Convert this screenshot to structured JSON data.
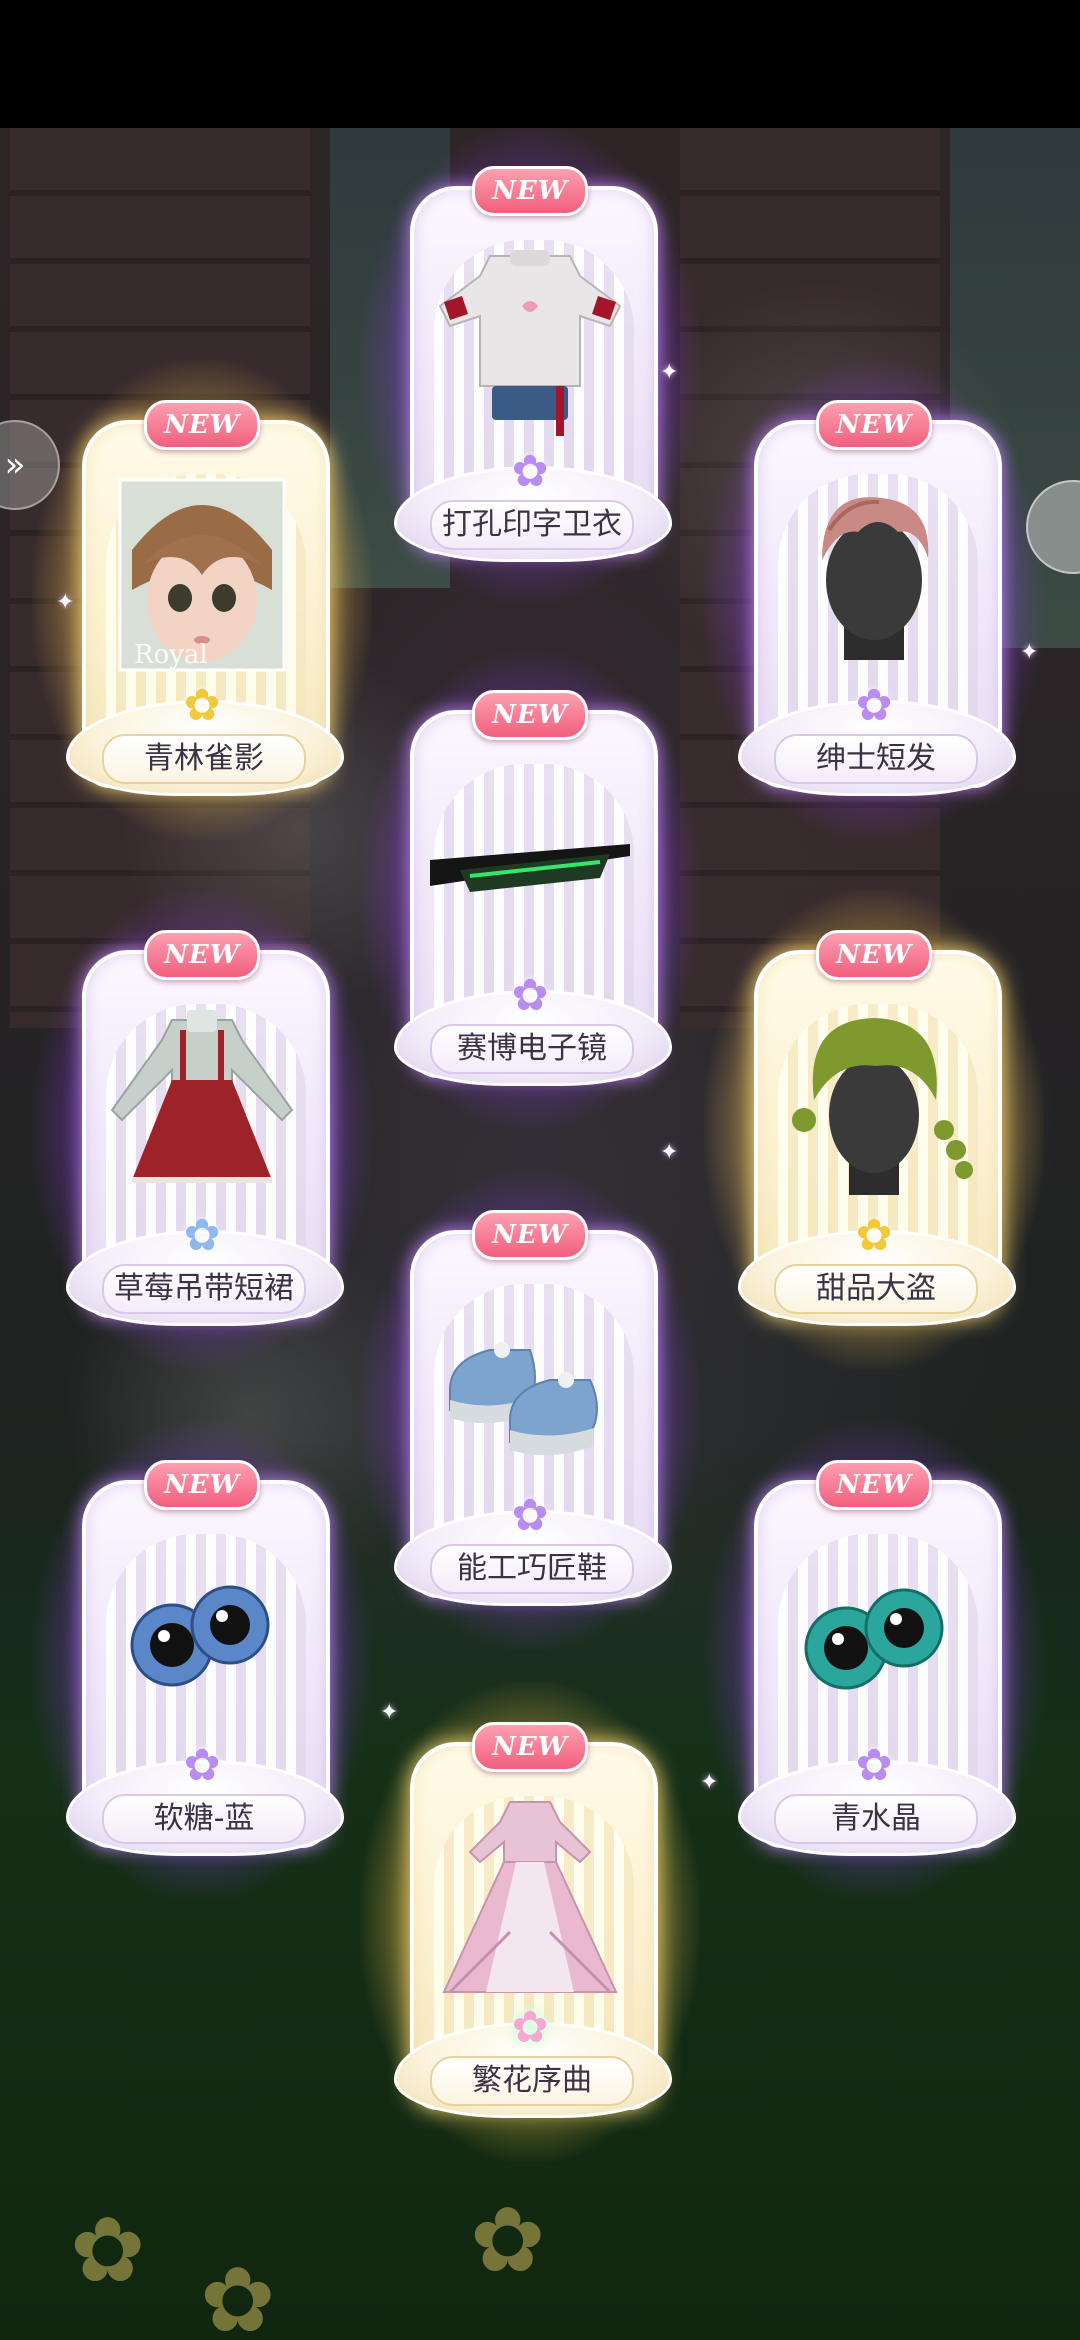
{
  "ui": {
    "new_badge": "NEW",
    "accent_color": "#a850ff",
    "legendary_color": "#ffd66e"
  },
  "portrait": {
    "watermark": "Royal"
  },
  "cards": [
    {
      "name": "打孔印字卫衣",
      "icon": "sweater-icon",
      "rarity": "purple"
    },
    {
      "name": "青林雀影",
      "icon": "portrait-icon",
      "rarity": "gold"
    },
    {
      "name": "绅士短发",
      "icon": "short-hair-icon",
      "rarity": "purple"
    },
    {
      "name": "赛博电子镜",
      "icon": "cyber-glasses-icon",
      "rarity": "purple"
    },
    {
      "name": "草莓吊带短裙",
      "icon": "strawberry-dress-icon",
      "rarity": "blue"
    },
    {
      "name": "甜品大盗",
      "icon": "green-hair-icon",
      "rarity": "gold"
    },
    {
      "name": "能工巧匠鞋",
      "icon": "sneakers-icon",
      "rarity": "purple"
    },
    {
      "name": "软糖-蓝",
      "icon": "blue-eyes-icon",
      "rarity": "purple"
    },
    {
      "name": "青水晶",
      "icon": "teal-eyes-icon",
      "rarity": "purple"
    },
    {
      "name": "繁花序曲",
      "icon": "flower-gown-icon",
      "rarity": "rainbow"
    }
  ]
}
